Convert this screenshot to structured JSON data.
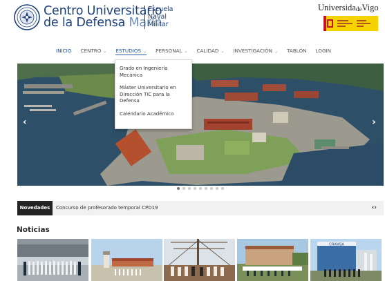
{
  "header": {
    "brand_line1": "Centro Universitario",
    "brand_line2a": "de la Defensa",
    "brand_line2b": "Marín",
    "escuela_line1": "Escuela",
    "escuela_line2": "Naval",
    "escuela_line3": "Militar",
    "uvigo_part1": "Universida",
    "uvigo_part2": "de",
    "uvigo_part3": "Vigo",
    "accent_color": "#1c3f7a"
  },
  "nav": {
    "items": [
      {
        "label": "INICIO"
      },
      {
        "label": "CENTRO"
      },
      {
        "label": "ESTUDIOS"
      },
      {
        "label": "PERSONAL"
      },
      {
        "label": "CALIDAD"
      },
      {
        "label": "INVESTIGACIÓN"
      },
      {
        "label": "TABLÓN"
      },
      {
        "label": "LOGIN"
      }
    ],
    "active_index": 2,
    "chevron_icon": "⌄"
  },
  "dropdown": {
    "items": [
      {
        "label": "Grado en Ingeniería Mecánica"
      },
      {
        "label": "Máster Universitario en Dirección TIC para la Defensa"
      },
      {
        "label": "Calendario Académico"
      }
    ]
  },
  "carousel": {
    "prev_icon": "‹",
    "next_icon": "›",
    "dot_count": 9,
    "active_dot": 0
  },
  "ticker": {
    "tag": "Novedades",
    "text": "Concurso de profesorado temporal CPD19",
    "controls": "‹›"
  },
  "news": {
    "title": "Noticias",
    "sign_text": "CRAMSA"
  }
}
